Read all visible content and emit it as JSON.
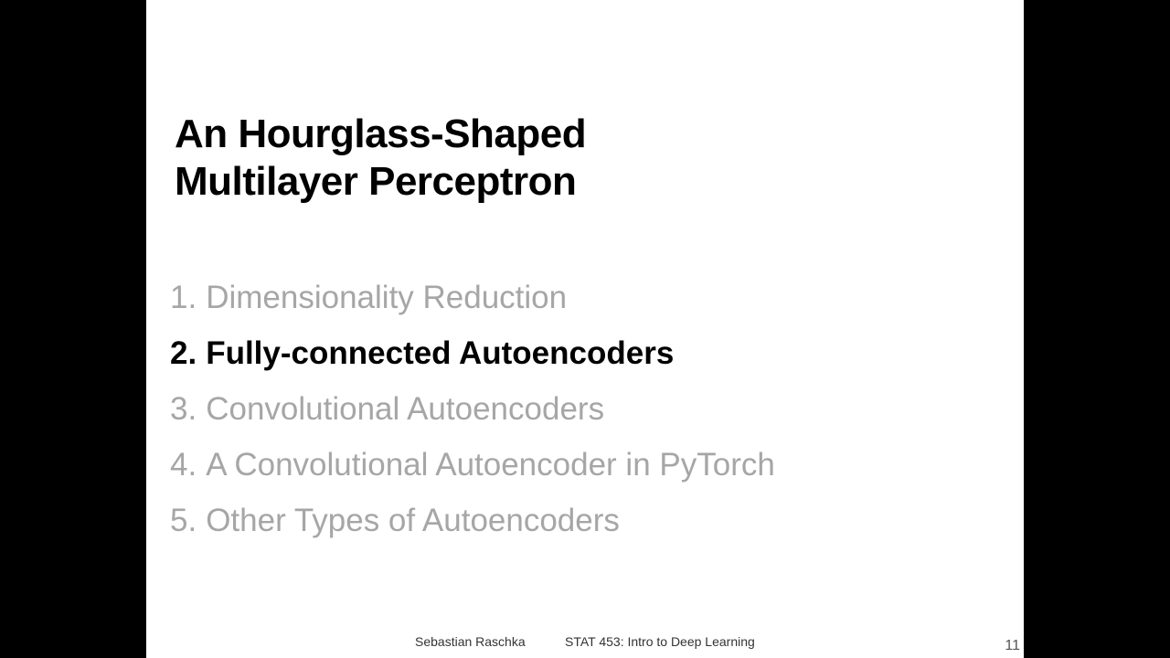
{
  "slide": {
    "title_lines": [
      "An Hourglass-Shaped",
      "Multilayer Perceptron"
    ],
    "agenda": [
      {
        "number": "1.",
        "label": "Dimensionality Reduction",
        "active": false
      },
      {
        "number": "2.",
        "label": "Fully-connected Autoencoders",
        "active": true
      },
      {
        "number": "3.",
        "label": "Convolutional Autoencoders",
        "active": false
      },
      {
        "number": "4.",
        "label": "A Convolutional Autoencoder in PyTorch",
        "active": false
      },
      {
        "number": "5.",
        "label": "Other Types of Autoencoders",
        "active": false
      }
    ],
    "footer": {
      "author": "Sebastian Raschka",
      "course": "STAT 453: Intro to Deep Learning",
      "page_number": "11"
    }
  },
  "colors": {
    "background": "#000000",
    "slide": "#ffffff",
    "active_text": "#000000",
    "inactive_text": "#a6a6a6"
  }
}
